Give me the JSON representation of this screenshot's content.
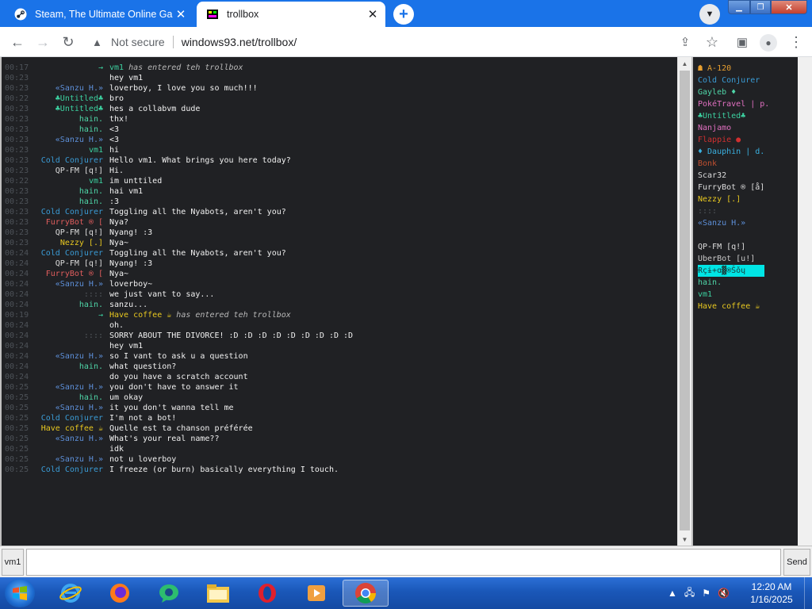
{
  "browser": {
    "tabs": [
      {
        "title": "Steam, The Ultimate Online Gam",
        "active": false
      },
      {
        "title": "trollbox",
        "active": true
      }
    ],
    "new_tab": "+",
    "tab_close": "✕",
    "security": "Not secure",
    "url": "windows93.net/trollbox/"
  },
  "chat": {
    "messages": [
      {
        "time": "00:17",
        "nick": "",
        "text": "",
        "system": true,
        "join_nick": "vm1",
        "join_color": "#3cd1a0",
        "join_text": " has entered teh trollbox"
      },
      {
        "time": "00:23",
        "nick": "",
        "nick_color": "#8a2be2",
        "text": "hey vm1"
      },
      {
        "time": "00:23",
        "nick": "«Sanzu H.»",
        "nick_color": "#5d8fd8",
        "text": "loverboy, I love you so much!!!"
      },
      {
        "time": "00:22",
        "nick": "♣Untitled♣",
        "nick_color": "#3cd1a0",
        "text": "bro"
      },
      {
        "time": "00:23",
        "nick": "♣Untitled♣",
        "nick_color": "#3cd1a0",
        "text": "hes a collabvm dude"
      },
      {
        "time": "00:23",
        "nick": "hain.",
        "nick_color": "#4fd6a8",
        "text": "thx!"
      },
      {
        "time": "00:23",
        "nick": "hain.",
        "nick_color": "#4fd6a8",
        "text": "<3"
      },
      {
        "time": "00:23",
        "nick": "«Sanzu H.»",
        "nick_color": "#5d8fd8",
        "text": "<3"
      },
      {
        "time": "00:23",
        "nick": "vm1",
        "nick_color": "#3cd1a0",
        "text": "hi"
      },
      {
        "time": "00:23",
        "nick": "Cold Conjurer",
        "nick_color": "#3a9bd5",
        "text": "Hello vm1. What brings you here today?"
      },
      {
        "time": "00:23",
        "nick": "QP-FM [q!]",
        "nick_color": "#dcdcdc",
        "text": "Hi."
      },
      {
        "time": "00:22",
        "nick": "vm1",
        "nick_color": "#3cd1a0",
        "text": "im unttiled"
      },
      {
        "time": "00:23",
        "nick": "hain.",
        "nick_color": "#4fd6a8",
        "text": "hai vm1"
      },
      {
        "time": "00:23",
        "nick": "hain.",
        "nick_color": "#4fd6a8",
        "text": ":3"
      },
      {
        "time": "00:23",
        "nick": "Cold Conjurer",
        "nick_color": "#3a9bd5",
        "text": "Toggling all the Nyabots, aren't you?"
      },
      {
        "time": "00:23",
        "nick": "FurryBot ® [",
        "nick_color": "#e05d5d",
        "text": "Nya?"
      },
      {
        "time": "00:23",
        "nick": "QP-FM [q!]",
        "nick_color": "#dcdcdc",
        "text": "Nyang! :3"
      },
      {
        "time": "00:23",
        "nick": "Nezzy [.]",
        "nick_color": "#e8c820",
        "text": "Nya~"
      },
      {
        "time": "00:24",
        "nick": "Cold Conjurer",
        "nick_color": "#3a9bd5",
        "text": "Toggling all the Nyabots, aren't you?"
      },
      {
        "time": "00:24",
        "nick": "QP-FM [q!]",
        "nick_color": "#dcdcdc",
        "text": "Nyang! :3"
      },
      {
        "time": "00:24",
        "nick": "FurryBot ® [",
        "nick_color": "#e05d5d",
        "text": "Nya~"
      },
      {
        "time": "00:24",
        "nick": "«Sanzu H.»",
        "nick_color": "#5d8fd8",
        "text": "loverboy~"
      },
      {
        "time": "00:24",
        "nick": "::::",
        "nick_color": "#555a60",
        "text": "we just vant to say..."
      },
      {
        "time": "00:24",
        "nick": "hain.",
        "nick_color": "#4fd6a8",
        "text": "sanzu..."
      },
      {
        "time": "00:19",
        "nick": "",
        "text": "",
        "system": true,
        "join_nick": "Have coffee ☕",
        "join_color": "#e8c820",
        "join_text": " has entered teh trollbox"
      },
      {
        "time": "00:24",
        "nick": "",
        "nick_color": "#8a2be2",
        "text": "oh."
      },
      {
        "time": "00:24",
        "nick": "::::",
        "nick_color": "#555a60",
        "text": "SORRY ABOUT THE DIVORCE! :D :D :D :D :D :D :D :D :D"
      },
      {
        "time": "00:24",
        "nick": "",
        "nick_color": "#8a2be2",
        "text": "hey vm1"
      },
      {
        "time": "00:24",
        "nick": "«Sanzu H.»",
        "nick_color": "#5d8fd8",
        "text": "so I vant to ask u a question"
      },
      {
        "time": "00:24",
        "nick": "hain.",
        "nick_color": "#4fd6a8",
        "text": "what question?"
      },
      {
        "time": "00:24",
        "nick": "",
        "nick_color": "#8a2be2",
        "text": "do you have a scratch account"
      },
      {
        "time": "00:25",
        "nick": "«Sanzu H.»",
        "nick_color": "#5d8fd8",
        "text": "you don't have to answer it"
      },
      {
        "time": "00:25",
        "nick": "hain.",
        "nick_color": "#4fd6a8",
        "text": "um okay"
      },
      {
        "time": "00:25",
        "nick": "«Sanzu H.»",
        "nick_color": "#5d8fd8",
        "text": "it you don't wanna tell me"
      },
      {
        "time": "00:25",
        "nick": "Cold Conjurer",
        "nick_color": "#3a9bd5",
        "text": "I'm not a bot!"
      },
      {
        "time": "00:25",
        "nick": "Have coffee ☕",
        "nick_color": "#e8c820",
        "text": "Quelle est ta chanson préférée"
      },
      {
        "time": "00:25",
        "nick": "«Sanzu H.»",
        "nick_color": "#5d8fd8",
        "text": "What's your real name??"
      },
      {
        "time": "00:25",
        "nick": "",
        "nick_color": "#8a2be2",
        "text": "idk"
      },
      {
        "time": "00:25",
        "nick": "«Sanzu H.»",
        "nick_color": "#5d8fd8",
        "text": "not u loverboy"
      },
      {
        "time": "00:25",
        "nick": "Cold Conjurer",
        "nick_color": "#3a9bd5",
        "text": "I freeze (or burn) basically everything I touch."
      }
    ]
  },
  "users": [
    {
      "name": "☗ A-120",
      "color": "#e8a030"
    },
    {
      "name": "Cold Conjurer",
      "color": "#3a9bd5"
    },
    {
      "name": "Gayleb ♦",
      "color": "#4fd6a8"
    },
    {
      "name": "PokéTravel | p.",
      "color": "#e070c0"
    },
    {
      "name": "♣Untitled♣",
      "color": "#3cd1a0"
    },
    {
      "name": "Nanjamo",
      "color": "#e070c0"
    },
    {
      "name": "Flappie ●",
      "color": "#d03030"
    },
    {
      "name": "♦ Dauphin | d.",
      "color": "#3ab0e0"
    },
    {
      "name": "Bonk",
      "color": "#c05030"
    },
    {
      "name": "Scar32",
      "color": "#dcdcdc"
    },
    {
      "name": "FurryBot ® [å]",
      "color": "#dcdcdc"
    },
    {
      "name": "Nezzy [.]",
      "color": "#e8c820"
    },
    {
      "name": "::::",
      "color": "#555a60"
    },
    {
      "name": "«Sanzu H.»",
      "color": "#5d8fd8"
    },
    {
      "name": "",
      "color": "#8a2be2"
    },
    {
      "name": "QP-FM [q!]",
      "color": "#dcdcdc"
    },
    {
      "name": "UberBot [u!]",
      "color": "#c8c8c8"
    },
    {
      "name": "Ɍçɨ+ɑ▓®Ŝǒɥ",
      "color": "#00e5e5"
    },
    {
      "name": "hain.",
      "color": "#4fd6a8"
    },
    {
      "name": "vm1",
      "color": "#3cd1a0"
    },
    {
      "name": "Have coffee ☕",
      "color": "#e8c820"
    }
  ],
  "input": {
    "nick_label": "vm1",
    "placeholder": "",
    "send_label": "Send"
  },
  "taskbar": {
    "time": "12:20 AM",
    "date": "1/16/2025"
  }
}
